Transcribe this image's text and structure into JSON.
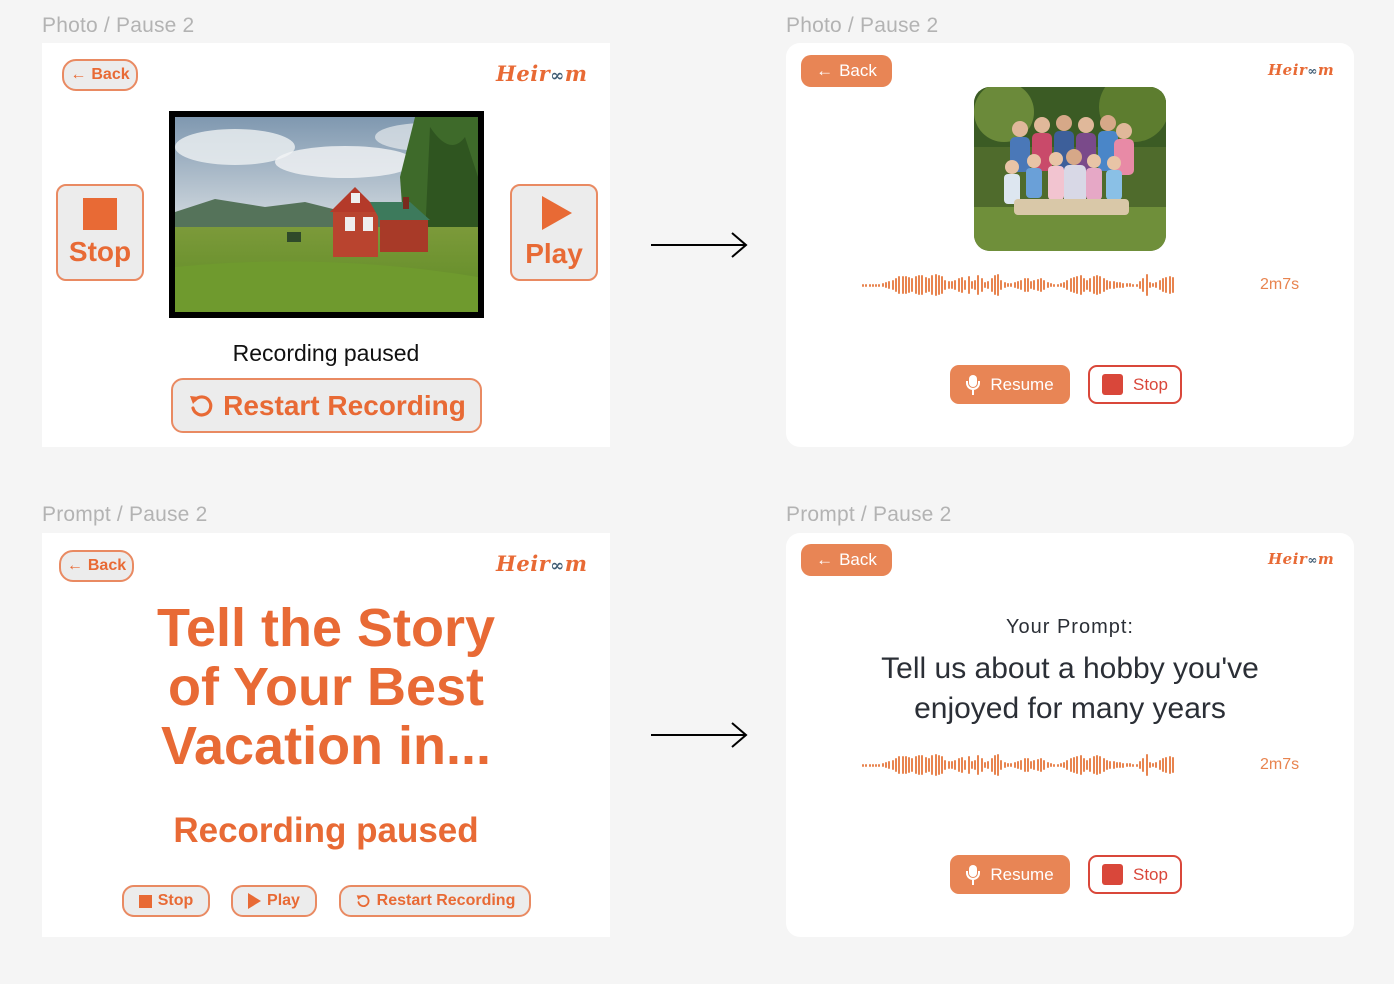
{
  "frames": {
    "photo_old": {
      "label": "Photo / Pause 2",
      "back": "Back",
      "logo_pre": "Heir",
      "logo_oo": "∞",
      "logo_post": "m",
      "stop": "Stop",
      "play": "Play",
      "status": "Recording paused",
      "restart": "Restart Recording"
    },
    "photo_new": {
      "label": "Photo / Pause 2",
      "back": "Back",
      "logo_pre": "Heir",
      "logo_oo": "∞",
      "logo_post": "m",
      "duration": "2m7s",
      "resume": "Resume",
      "stop": "Stop"
    },
    "prompt_old": {
      "label": "Prompt / Pause 2",
      "back": "Back",
      "logo_pre": "Heir",
      "logo_oo": "∞",
      "logo_post": "m",
      "headline_1": "Tell the Story",
      "headline_2": "of Your Best",
      "headline_3": "Vacation in...",
      "status": "Recording paused",
      "stop": "Stop",
      "play": "Play",
      "restart": "Restart Recording"
    },
    "prompt_new": {
      "label": "Prompt / Pause 2",
      "back": "Back",
      "logo_pre": "Heir",
      "logo_oo": "∞",
      "logo_post": "m",
      "prompt_label": "Your Prompt:",
      "prompt_line_1": "Tell us about a hobby you've",
      "prompt_line_2": "enjoyed for many years",
      "duration": "2m7s",
      "resume": "Resume",
      "stop": "Stop"
    }
  },
  "colors": {
    "accent": "#e86a35",
    "accent_fill": "#e88555",
    "stop_red": "#d9473a",
    "label_gray": "#b3b3b3",
    "prompt_text": "#2b2f36"
  },
  "icons": [
    "left-arrow-icon",
    "stop-square-icon",
    "play-triangle-icon",
    "restart-icon",
    "microphone-icon",
    "right-arrow-icon"
  ]
}
